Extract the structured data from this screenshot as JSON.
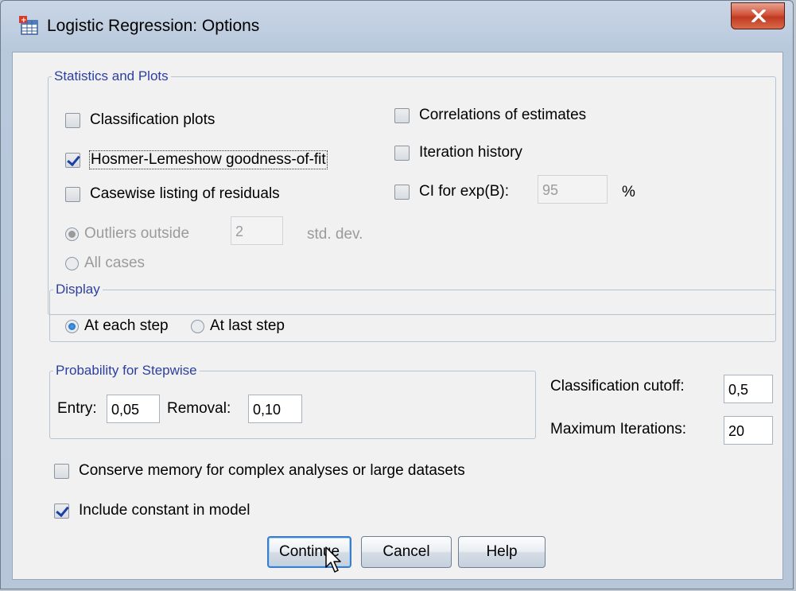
{
  "window": {
    "title": "Logistic Regression: Options",
    "icon": "spss-table-icon",
    "close_icon": "close-icon"
  },
  "stats_group": {
    "label": "Statistics and Plots",
    "classification_plots": {
      "label": "Classification plots",
      "checked": false
    },
    "hosmer": {
      "label": "Hosmer-Lemeshow goodness-of-fit",
      "checked": true
    },
    "casewise": {
      "label": "Casewise listing of residuals",
      "checked": false
    },
    "outliers": {
      "label": "Outliers outside",
      "value": "2",
      "unit": "std. dev.",
      "selected": true,
      "enabled": false
    },
    "all_cases": {
      "label": "All cases",
      "selected": false,
      "enabled": false
    },
    "correlations": {
      "label": "Correlations of estimates",
      "checked": false
    },
    "iteration": {
      "label": "Iteration history",
      "checked": false
    },
    "ci": {
      "label": "CI for exp(B):",
      "value": "95",
      "unit": "%",
      "checked": false
    }
  },
  "display_group": {
    "label": "Display",
    "each_step": {
      "label": "At each step",
      "selected": true
    },
    "last_step": {
      "label": "At last step",
      "selected": false
    }
  },
  "stepwise_group": {
    "label": "Probability for Stepwise",
    "entry": {
      "label": "Entry:",
      "value": "0,05"
    },
    "removal": {
      "label": "Removal:",
      "value": "0,10"
    }
  },
  "classification_cutoff": {
    "label": "Classification cutoff:",
    "value": "0,5"
  },
  "max_iterations": {
    "label": "Maximum Iterations:",
    "value": "20"
  },
  "conserve_memory": {
    "label": "Conserve memory for complex analyses or large datasets",
    "checked": false
  },
  "include_constant": {
    "label": "Include constant in model",
    "checked": true
  },
  "buttons": {
    "continue": "Continue",
    "cancel": "Cancel",
    "help": "Help"
  },
  "colors": {
    "group_label": "#2c3fa0",
    "close_button": "#c9462c",
    "default_button_border": "#3b7dc8"
  }
}
